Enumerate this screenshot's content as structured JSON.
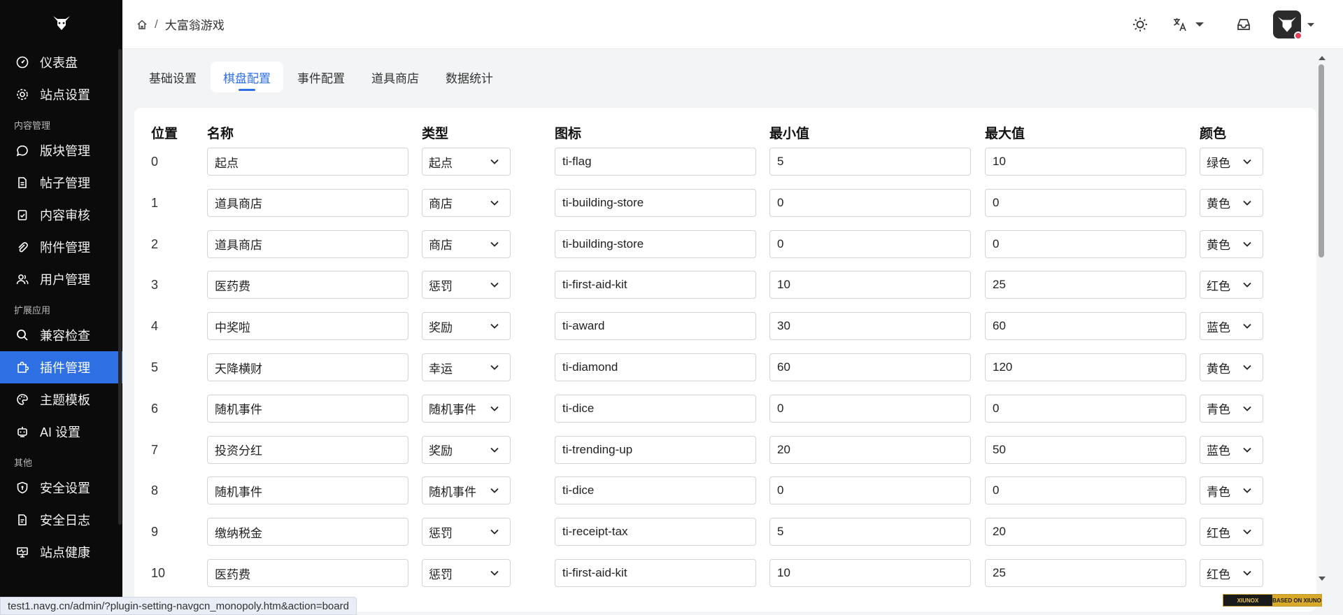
{
  "sidebar": {
    "items": [
      {
        "label": "仪表盘",
        "icon": "dashboard-icon"
      },
      {
        "label": "站点设置",
        "icon": "gear-icon"
      }
    ],
    "sections": [
      {
        "title": "内容管理",
        "items": [
          {
            "label": "版块管理",
            "icon": "chat-bubble-icon"
          },
          {
            "label": "帖子管理",
            "icon": "document-icon"
          },
          {
            "label": "内容审核",
            "icon": "clipboard-check-icon"
          },
          {
            "label": "附件管理",
            "icon": "paperclip-icon"
          },
          {
            "label": "用户管理",
            "icon": "users-icon"
          }
        ]
      },
      {
        "title": "扩展应用",
        "items": [
          {
            "label": "兼容检查",
            "icon": "search-icon"
          },
          {
            "label": "插件管理",
            "icon": "puzzle-icon",
            "active": true
          },
          {
            "label": "主题模板",
            "icon": "palette-icon"
          },
          {
            "label": "AI 设置",
            "icon": "robot-icon"
          }
        ]
      },
      {
        "title": "其他",
        "items": [
          {
            "label": "安全设置",
            "icon": "shield-icon"
          },
          {
            "label": "安全日志",
            "icon": "log-icon"
          },
          {
            "label": "站点健康",
            "icon": "monitor-heart-icon"
          }
        ]
      }
    ]
  },
  "header": {
    "breadcrumb": {
      "home_icon": "home-icon",
      "separator": "/",
      "current": "大富翁游戏"
    },
    "actions": {
      "theme_icon": "sun-icon",
      "language_icon": "translate-icon",
      "inbox_icon": "inbox-icon",
      "avatar": "user-avatar"
    }
  },
  "tabs": [
    {
      "label": "基础设置"
    },
    {
      "label": "棋盘配置",
      "active": true
    },
    {
      "label": "事件配置"
    },
    {
      "label": "道具商店"
    },
    {
      "label": "数据统计"
    }
  ],
  "table": {
    "headers": {
      "position": "位置",
      "name": "名称",
      "type": "类型",
      "icon": "图标",
      "min": "最小值",
      "max": "最大值",
      "color": "颜色"
    },
    "rows": [
      {
        "position": "0",
        "name": "起点",
        "type": "起点",
        "icon": "ti-flag",
        "min": "5",
        "max": "10",
        "color": "绿色"
      },
      {
        "position": "1",
        "name": "道具商店",
        "type": "商店",
        "icon": "ti-building-store",
        "min": "0",
        "max": "0",
        "color": "黄色"
      },
      {
        "position": "2",
        "name": "道具商店",
        "type": "商店",
        "icon": "ti-building-store",
        "min": "0",
        "max": "0",
        "color": "黄色"
      },
      {
        "position": "3",
        "name": "医药费",
        "type": "惩罚",
        "icon": "ti-first-aid-kit",
        "min": "10",
        "max": "25",
        "color": "红色"
      },
      {
        "position": "4",
        "name": "中奖啦",
        "type": "奖励",
        "icon": "ti-award",
        "min": "30",
        "max": "60",
        "color": "蓝色"
      },
      {
        "position": "5",
        "name": "天降横财",
        "type": "幸运",
        "icon": "ti-diamond",
        "min": "60",
        "max": "120",
        "color": "黄色"
      },
      {
        "position": "6",
        "name": "随机事件",
        "type": "随机事件",
        "icon": "ti-dice",
        "min": "0",
        "max": "0",
        "color": "青色"
      },
      {
        "position": "7",
        "name": "投资分红",
        "type": "奖励",
        "icon": "ti-trending-up",
        "min": "20",
        "max": "50",
        "color": "蓝色"
      },
      {
        "position": "8",
        "name": "随机事件",
        "type": "随机事件",
        "icon": "ti-dice",
        "min": "0",
        "max": "0",
        "color": "青色"
      },
      {
        "position": "9",
        "name": "缴纳税金",
        "type": "惩罚",
        "icon": "ti-receipt-tax",
        "min": "5",
        "max": "20",
        "color": "红色"
      },
      {
        "position": "10",
        "name": "医药费",
        "type": "惩罚",
        "icon": "ti-first-aid-kit",
        "min": "10",
        "max": "25",
        "color": "红色"
      }
    ]
  },
  "statusbar": {
    "url": "test1.navg.cn/admin/?plugin-setting-navgcn_monopoly.htm&action=board"
  },
  "badge": {
    "left": "XIUNOX",
    "right": "BASED ON XIUNO"
  },
  "colors": {
    "accent": "#2f6fe4",
    "sidebar_bg": "#0b0b0b"
  }
}
